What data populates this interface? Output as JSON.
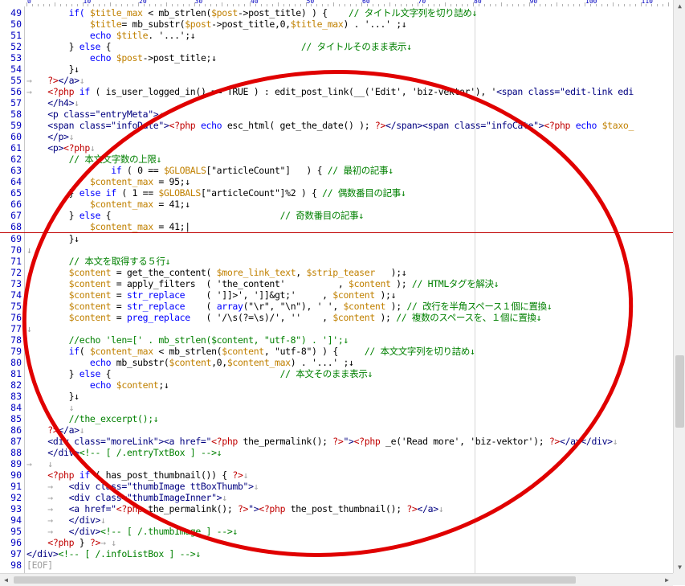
{
  "ruler": {
    "labels": [
      "0",
      "10",
      "20",
      "30",
      "40",
      "50",
      "60",
      "70",
      "80",
      "90",
      "100",
      "110"
    ]
  },
  "editor": {
    "eof_marker": "[EOF]",
    "current_line": 68,
    "lines": [
      {
        "n": "49",
        "segs": [
          [
            "        ",
            "#000000"
          ],
          [
            "if( ",
            "#0000ff"
          ],
          [
            "$title_max",
            "#c08000"
          ],
          [
            " < mb_strlen(",
            "#000000"
          ],
          [
            "$post",
            "#c08000"
          ],
          [
            "->post_title) ) {    ",
            "#000000"
          ],
          [
            "// タイトル文字列を切り詰め↓",
            "#008000"
          ]
        ]
      },
      {
        "n": "50",
        "segs": [
          [
            "            ",
            "#000000"
          ],
          [
            "$title",
            "#c08000"
          ],
          [
            "= mb_substr(",
            "#000000"
          ],
          [
            "$post",
            "#c08000"
          ],
          [
            "->post_title,0,",
            "#000000"
          ],
          [
            "$title_max",
            "#c08000"
          ],
          [
            ") . '...' ;↓",
            "#000000"
          ]
        ]
      },
      {
        "n": "51",
        "segs": [
          [
            "            ",
            "#000000"
          ],
          [
            "echo",
            "#0000ff"
          ],
          [
            " ",
            "#000000"
          ],
          [
            "$title",
            "#c08000"
          ],
          [
            ". '...';↓",
            "#000000"
          ]
        ]
      },
      {
        "n": "52",
        "segs": [
          [
            "        } ",
            "#000000"
          ],
          [
            "else",
            "#0000ff"
          ],
          [
            " {                                    ",
            "#000000"
          ],
          [
            "// タイトルそのまま表示↓",
            "#008000"
          ]
        ]
      },
      {
        "n": "53",
        "segs": [
          [
            "            ",
            "#000000"
          ],
          [
            "echo",
            "#0000ff"
          ],
          [
            " ",
            "#000000"
          ],
          [
            "$post",
            "#c08000"
          ],
          [
            "->post_title;↓",
            "#000000"
          ]
        ]
      },
      {
        "n": "54",
        "segs": [
          [
            "        }↓",
            "#000000"
          ]
        ]
      },
      {
        "n": "55",
        "segs": [
          [
            "→   ",
            "#a0a0a0"
          ],
          [
            "?>",
            "#c00000"
          ],
          [
            "</a>",
            "#000080"
          ],
          [
            "↓",
            "#a0a0a0"
          ]
        ]
      },
      {
        "n": "56",
        "segs": [
          [
            "→   ",
            "#a0a0a0"
          ],
          [
            "<?php",
            "#c00000"
          ],
          [
            " ",
            "#000000"
          ],
          [
            "if",
            "#0000ff"
          ],
          [
            " ( is_user_logged_in() == TRUE ) : edit_post_link(__('Edit', 'biz-vektor'), '",
            "#000000"
          ],
          [
            "<span class=\"edit-link edi",
            "#000080"
          ]
        ]
      },
      {
        "n": "57",
        "segs": [
          [
            "    ",
            "#000000"
          ],
          [
            "</h4>",
            "#000080"
          ],
          [
            "↓",
            "#a0a0a0"
          ]
        ]
      },
      {
        "n": "58",
        "segs": [
          [
            "    ",
            "#000000"
          ],
          [
            "<p class=\"entryMeta\">",
            "#000080"
          ],
          [
            "↓",
            "#a0a0a0"
          ]
        ]
      },
      {
        "n": "59",
        "segs": [
          [
            "    ",
            "#000000"
          ],
          [
            "<span class=\"infoDate\">",
            "#000080"
          ],
          [
            "<?php",
            "#c00000"
          ],
          [
            " ",
            "#000000"
          ],
          [
            "echo",
            "#0000ff"
          ],
          [
            " esc_html( get_the_date() ); ",
            "#000000"
          ],
          [
            "?>",
            "#c00000"
          ],
          [
            "</span><span class=\"infoCate\">",
            "#000080"
          ],
          [
            "<?php",
            "#c00000"
          ],
          [
            " ",
            "#000000"
          ],
          [
            "echo",
            "#0000ff"
          ],
          [
            " ",
            "#000000"
          ],
          [
            "$taxo_",
            "#c08000"
          ]
        ]
      },
      {
        "n": "60",
        "segs": [
          [
            "    ",
            "#000000"
          ],
          [
            "</p>",
            "#000080"
          ],
          [
            "↓",
            "#a0a0a0"
          ]
        ]
      },
      {
        "n": "61",
        "segs": [
          [
            "    ",
            "#000000"
          ],
          [
            "<p>",
            "#000080"
          ],
          [
            "<?php",
            "#c00000"
          ],
          [
            "↓",
            "#a0a0a0"
          ]
        ]
      },
      {
        "n": "62",
        "segs": [
          [
            "        ",
            "#000000"
          ],
          [
            "// 本文文字数の上限↓",
            "#008000"
          ]
        ]
      },
      {
        "n": "63",
        "segs": [
          [
            "                ",
            "#000000"
          ],
          [
            "if",
            "#0000ff"
          ],
          [
            " ( 0 == ",
            "#000000"
          ],
          [
            "$GLOBALS",
            "#c08000"
          ],
          [
            "[\"articleCount\"]   ) { ",
            "#000000"
          ],
          [
            "// 最初の記事↓",
            "#008000"
          ]
        ]
      },
      {
        "n": "64",
        "segs": [
          [
            "            ",
            "#000000"
          ],
          [
            "$content_max",
            "#c08000"
          ],
          [
            " = 95;↓",
            "#000000"
          ]
        ]
      },
      {
        "n": "65",
        "segs": [
          [
            "        } ",
            "#000000"
          ],
          [
            "else if",
            "#0000ff"
          ],
          [
            " ( 1 == ",
            "#000000"
          ],
          [
            "$GLOBALS",
            "#c08000"
          ],
          [
            "[\"articleCount\"]%2 ) { ",
            "#000000"
          ],
          [
            "// 偶数番目の記事↓",
            "#008000"
          ]
        ]
      },
      {
        "n": "66",
        "segs": [
          [
            "            ",
            "#000000"
          ],
          [
            "$content_max",
            "#c08000"
          ],
          [
            " = 41;↓",
            "#000000"
          ]
        ]
      },
      {
        "n": "67",
        "segs": [
          [
            "        } ",
            "#000000"
          ],
          [
            "else",
            "#0000ff"
          ],
          [
            " {                                ",
            "#000000"
          ],
          [
            "// 奇数番目の記事↓",
            "#008000"
          ]
        ]
      },
      {
        "n": "68",
        "segs": [
          [
            "            ",
            "#000000"
          ],
          [
            "$content_max",
            "#c08000"
          ],
          [
            " = 41;|",
            "#000000"
          ]
        ]
      },
      {
        "n": "69",
        "segs": [
          [
            "        }↓",
            "#000000"
          ]
        ]
      },
      {
        "n": "70",
        "segs": [
          [
            "↓",
            "#a0a0a0"
          ]
        ]
      },
      {
        "n": "71",
        "segs": [
          [
            "        ",
            "#000000"
          ],
          [
            "// 本文を取得する５行↓",
            "#008000"
          ]
        ]
      },
      {
        "n": "72",
        "segs": [
          [
            "        ",
            "#000000"
          ],
          [
            "$content",
            "#c08000"
          ],
          [
            " = get_the_content( ",
            "#000000"
          ],
          [
            "$more_link_text",
            "#c08000"
          ],
          [
            ", ",
            "#000000"
          ],
          [
            "$strip_teaser",
            "#c08000"
          ],
          [
            "   );↓",
            "#000000"
          ]
        ]
      },
      {
        "n": "73",
        "segs": [
          [
            "        ",
            "#000000"
          ],
          [
            "$content",
            "#c08000"
          ],
          [
            " = apply_filters  ( 'the_content'          , ",
            "#000000"
          ],
          [
            "$content",
            "#c08000"
          ],
          [
            " ); ",
            "#000000"
          ],
          [
            "// HTMLタグを解決↓",
            "#008000"
          ]
        ]
      },
      {
        "n": "74",
        "segs": [
          [
            "        ",
            "#000000"
          ],
          [
            "$content",
            "#c08000"
          ],
          [
            " = ",
            "#000000"
          ],
          [
            "str_replace",
            "#0000ff"
          ],
          [
            "    ( ']]>', ']]&gt;'     , ",
            "#000000"
          ],
          [
            "$content",
            "#c08000"
          ],
          [
            " );↓",
            "#000000"
          ]
        ]
      },
      {
        "n": "75",
        "segs": [
          [
            "        ",
            "#000000"
          ],
          [
            "$content",
            "#c08000"
          ],
          [
            " = ",
            "#000000"
          ],
          [
            "str_replace",
            "#0000ff"
          ],
          [
            "    ( ",
            "#000000"
          ],
          [
            "array",
            "#0000ff"
          ],
          [
            "(\"\\r\", \"\\n\"), ' ', ",
            "#000000"
          ],
          [
            "$content",
            "#c08000"
          ],
          [
            " ); ",
            "#000000"
          ],
          [
            "// 改行を半角スペース１個に置換↓",
            "#008000"
          ]
        ]
      },
      {
        "n": "76",
        "segs": [
          [
            "        ",
            "#000000"
          ],
          [
            "$content",
            "#c08000"
          ],
          [
            " = ",
            "#000000"
          ],
          [
            "preg_replace",
            "#0000ff"
          ],
          [
            "   ( '/\\s(?=\\s)/', ''    , ",
            "#000000"
          ],
          [
            "$content",
            "#c08000"
          ],
          [
            " ); ",
            "#000000"
          ],
          [
            "// 複数のスペースを、１個に置換↓",
            "#008000"
          ]
        ]
      },
      {
        "n": "77",
        "segs": [
          [
            "↓",
            "#a0a0a0"
          ]
        ]
      },
      {
        "n": "78",
        "segs": [
          [
            "        ",
            "#000000"
          ],
          [
            "//echo 'len=[' . mb_strlen($content, \"utf-8\") . ']';↓",
            "#008000"
          ]
        ]
      },
      {
        "n": "79",
        "segs": [
          [
            "        ",
            "#000000"
          ],
          [
            "if",
            "#0000ff"
          ],
          [
            "( ",
            "#000000"
          ],
          [
            "$content_max",
            "#c08000"
          ],
          [
            " < mb_strlen(",
            "#000000"
          ],
          [
            "$content",
            "#c08000"
          ],
          [
            ", \"utf-8\") ) {     ",
            "#000000"
          ],
          [
            "// 本文文字列を切り詰め↓",
            "#008000"
          ]
        ]
      },
      {
        "n": "80",
        "segs": [
          [
            "            ",
            "#000000"
          ],
          [
            "echo",
            "#0000ff"
          ],
          [
            " mb_substr(",
            "#000000"
          ],
          [
            "$content",
            "#c08000"
          ],
          [
            ",0,",
            "#000000"
          ],
          [
            "$content_max",
            "#c08000"
          ],
          [
            ") . '...' ;↓",
            "#000000"
          ]
        ]
      },
      {
        "n": "81",
        "segs": [
          [
            "        } ",
            "#000000"
          ],
          [
            "else",
            "#0000ff"
          ],
          [
            " {                                ",
            "#000000"
          ],
          [
            "// 本文そのまま表示↓",
            "#008000"
          ]
        ]
      },
      {
        "n": "82",
        "segs": [
          [
            "            ",
            "#000000"
          ],
          [
            "echo",
            "#0000ff"
          ],
          [
            " ",
            "#000000"
          ],
          [
            "$content",
            "#c08000"
          ],
          [
            ";↓",
            "#000000"
          ]
        ]
      },
      {
        "n": "83",
        "segs": [
          [
            "        }↓",
            "#000000"
          ]
        ]
      },
      {
        "n": "84",
        "segs": [
          [
            "        ↓",
            "#a0a0a0"
          ]
        ]
      },
      {
        "n": "85",
        "segs": [
          [
            "        ",
            "#000000"
          ],
          [
            "//the_excerpt();↓",
            "#008000"
          ]
        ]
      },
      {
        "n": "86",
        "segs": [
          [
            "    ",
            "#000000"
          ],
          [
            "?>",
            "#c00000"
          ],
          [
            "</a>",
            "#000080"
          ],
          [
            "↓",
            "#a0a0a0"
          ]
        ]
      },
      {
        "n": "87",
        "segs": [
          [
            "    ",
            "#000000"
          ],
          [
            "<div class=\"moreLink\"><a href=\"",
            "#000080"
          ],
          [
            "<?php",
            "#c00000"
          ],
          [
            " the_permalink(); ",
            "#000000"
          ],
          [
            "?>",
            "#c00000"
          ],
          [
            "\">",
            "#000080"
          ],
          [
            "<?php",
            "#c00000"
          ],
          [
            " _e('Read more', 'biz-vektor'); ",
            "#000000"
          ],
          [
            "?>",
            "#c00000"
          ],
          [
            "</a></div>",
            "#000080"
          ],
          [
            "↓",
            "#a0a0a0"
          ]
        ]
      },
      {
        "n": "88",
        "segs": [
          [
            "    ",
            "#000000"
          ],
          [
            "</div>",
            "#000080"
          ],
          [
            "<!-- [ /.entryTxtBox ] -->↓",
            "#008000"
          ]
        ]
      },
      {
        "n": "89",
        "segs": [
          [
            "→   ↓",
            "#a0a0a0"
          ]
        ]
      },
      {
        "n": "90",
        "segs": [
          [
            "    ",
            "#000000"
          ],
          [
            "<?php",
            "#c00000"
          ],
          [
            " ",
            "#000000"
          ],
          [
            "if",
            "#0000ff"
          ],
          [
            " ( has_post_thumbnail()) { ",
            "#000000"
          ],
          [
            "?>",
            "#c00000"
          ],
          [
            "↓",
            "#a0a0a0"
          ]
        ]
      },
      {
        "n": "91",
        "segs": [
          [
            "    →   ",
            "#a0a0a0"
          ],
          [
            "<div class=\"thumbImage ttBoxThumb\">",
            "#000080"
          ],
          [
            "↓",
            "#a0a0a0"
          ]
        ]
      },
      {
        "n": "92",
        "segs": [
          [
            "    →   ",
            "#a0a0a0"
          ],
          [
            "<div class=\"thumbImageInner\">",
            "#000080"
          ],
          [
            "↓",
            "#a0a0a0"
          ]
        ]
      },
      {
        "n": "93",
        "segs": [
          [
            "    →   ",
            "#a0a0a0"
          ],
          [
            "<a href=\"",
            "#000080"
          ],
          [
            "<?php",
            "#c00000"
          ],
          [
            " the_permalink(); ",
            "#000000"
          ],
          [
            "?>",
            "#c00000"
          ],
          [
            "\">",
            "#000080"
          ],
          [
            "<?php",
            "#c00000"
          ],
          [
            " the_post_thumbnail(); ",
            "#000000"
          ],
          [
            "?>",
            "#c00000"
          ],
          [
            "</a>",
            "#000080"
          ],
          [
            "↓",
            "#a0a0a0"
          ]
        ]
      },
      {
        "n": "94",
        "segs": [
          [
            "    →   ",
            "#a0a0a0"
          ],
          [
            "</div>",
            "#000080"
          ],
          [
            "↓",
            "#a0a0a0"
          ]
        ]
      },
      {
        "n": "95",
        "segs": [
          [
            "    →   ",
            "#a0a0a0"
          ],
          [
            "</div>",
            "#000080"
          ],
          [
            "<!-- [ /.thumbImage ] -->↓",
            "#008000"
          ]
        ]
      },
      {
        "n": "96",
        "segs": [
          [
            "    ",
            "#000000"
          ],
          [
            "<?php",
            "#c00000"
          ],
          [
            " } ",
            "#000000"
          ],
          [
            "?>",
            "#c00000"
          ],
          [
            "→ ↓",
            "#a0a0a0"
          ]
        ]
      },
      {
        "n": "97",
        "segs": [
          [
            "",
            "#000000"
          ],
          [
            "</div>",
            "#000080"
          ],
          [
            "<!-- [ /.infoListBox ] -->↓",
            "#008000"
          ]
        ]
      },
      {
        "n": "98",
        "segs": []
      }
    ]
  },
  "annotation": {
    "color": "#e00000",
    "shape": "ellipse-circle"
  },
  "scrollbars": {
    "vertical_position": 0.72,
    "horizontal_position": 0.0
  }
}
